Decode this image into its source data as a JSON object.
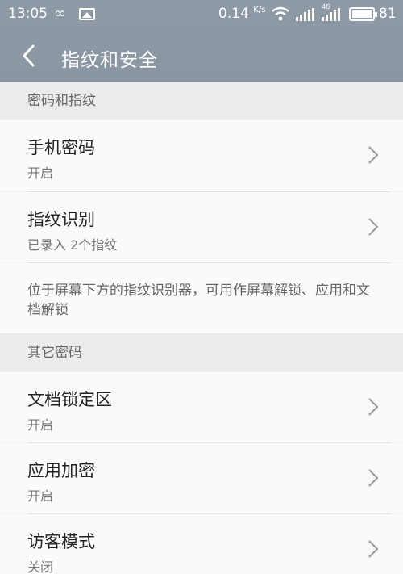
{
  "status_bar": {
    "time": "13:05",
    "net_speed": "0.14",
    "net_unit": "K/s",
    "net_badge": "4G",
    "battery": "81",
    "icons": [
      "infinity-icon",
      "image-icon",
      "wifi-icon",
      "signal-icon",
      "signal-icon",
      "battery-icon"
    ]
  },
  "header": {
    "title": "指纹和安全"
  },
  "section1": {
    "header": "密码和指纹",
    "items": [
      {
        "title": "手机密码",
        "subtitle": "开启"
      },
      {
        "title": "指纹识别",
        "subtitle": "已录入 2个指纹"
      }
    ],
    "note": "位于屏幕下方的指纹识别器，可用作屏幕解锁、应用和文档解锁"
  },
  "section2": {
    "header": "其它密码",
    "items": [
      {
        "title": "文档锁定区",
        "subtitle": "开启"
      },
      {
        "title": "应用加密",
        "subtitle": "开启"
      },
      {
        "title": "访客模式",
        "subtitle": "关闭"
      }
    ]
  },
  "colors": {
    "header_bg": "#8e9aa6",
    "list_bg": "#fafafa",
    "section_bg": "#ececec"
  }
}
